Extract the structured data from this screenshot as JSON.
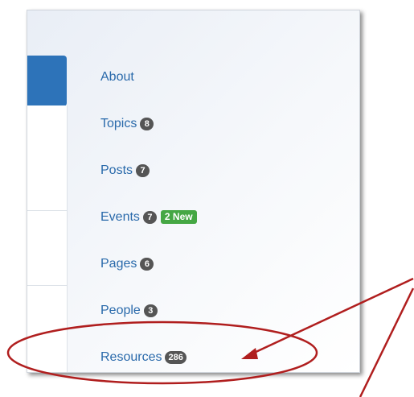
{
  "nav": {
    "items": [
      {
        "label": "About",
        "badge": null,
        "new": null
      },
      {
        "label": "Topics",
        "badge": "8",
        "new": null
      },
      {
        "label": "Posts",
        "badge": "7",
        "new": null
      },
      {
        "label": "Events",
        "badge": "7",
        "new": "2 New"
      },
      {
        "label": "Pages",
        "badge": "6",
        "new": null
      },
      {
        "label": "People",
        "badge": "3",
        "new": null
      },
      {
        "label": "Resources",
        "badge": "286",
        "new": null
      }
    ]
  },
  "annotation": {
    "color": "#b01e1e",
    "shape": "ellipse-with-arrows",
    "highlighted_item": "Resources"
  },
  "colors": {
    "link": "#2a6aab",
    "badge": "#555555",
    "new_badge": "#45a744",
    "accent_bar": "#2d73b9"
  }
}
